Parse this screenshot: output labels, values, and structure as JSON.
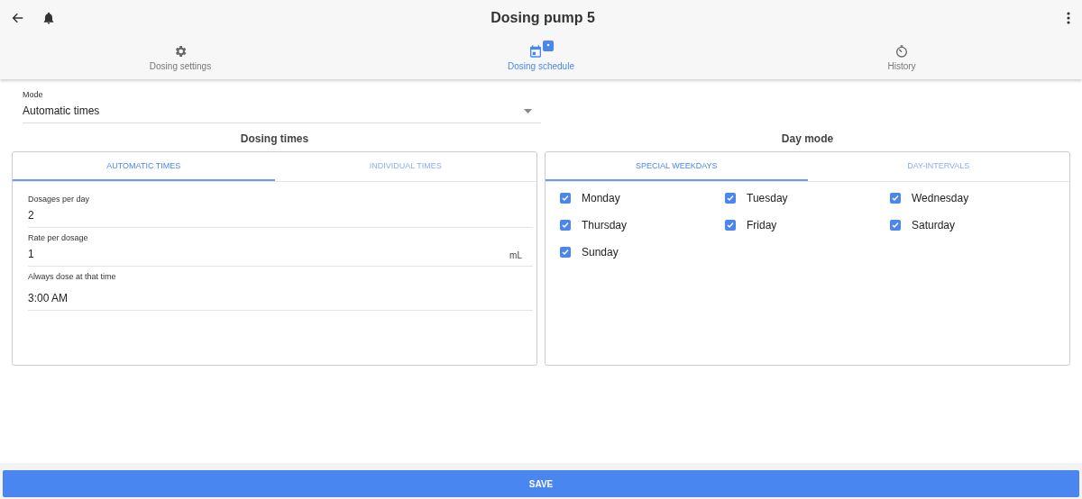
{
  "app_bar": {
    "title": "Dosing pump 5"
  },
  "tabs": [
    {
      "label": "Dosing settings",
      "kind": "gear",
      "selected": false,
      "badge": false
    },
    {
      "label": "Dosing schedule",
      "kind": "calendar",
      "selected": true,
      "badge": true
    },
    {
      "label": "History",
      "kind": "timer",
      "selected": false,
      "badge": false
    }
  ],
  "mode": {
    "label": "Mode",
    "value": "Automatic times"
  },
  "dosing_times": {
    "title": "Dosing times",
    "tabs": [
      {
        "label": "AUTOMATIC TIMES",
        "selected": true
      },
      {
        "label": "INDIVIDUAL TIMES",
        "selected": false
      }
    ],
    "fields": [
      {
        "label": "Dosages per day",
        "value": "2"
      },
      {
        "label": "Rate per dosage",
        "value": "1",
        "unit": "mL"
      },
      {
        "label": "Always dose at that time",
        "value": "3:00 AM"
      }
    ]
  },
  "day_mode": {
    "title": "Day mode",
    "tabs": [
      {
        "label": "SPECIAL WEEKDAYS",
        "selected": true
      },
      {
        "label": "DAY-INTERVALS",
        "selected": false
      }
    ],
    "days": [
      {
        "label": "Monday",
        "checked": true
      },
      {
        "label": "Tuesday",
        "checked": true
      },
      {
        "label": "Wednesday",
        "checked": true
      },
      {
        "label": "Thursday",
        "checked": true
      },
      {
        "label": "Friday",
        "checked": true
      },
      {
        "label": "Saturday",
        "checked": true
      },
      {
        "label": "Sunday",
        "checked": true
      }
    ]
  },
  "save_button": "SAVE"
}
